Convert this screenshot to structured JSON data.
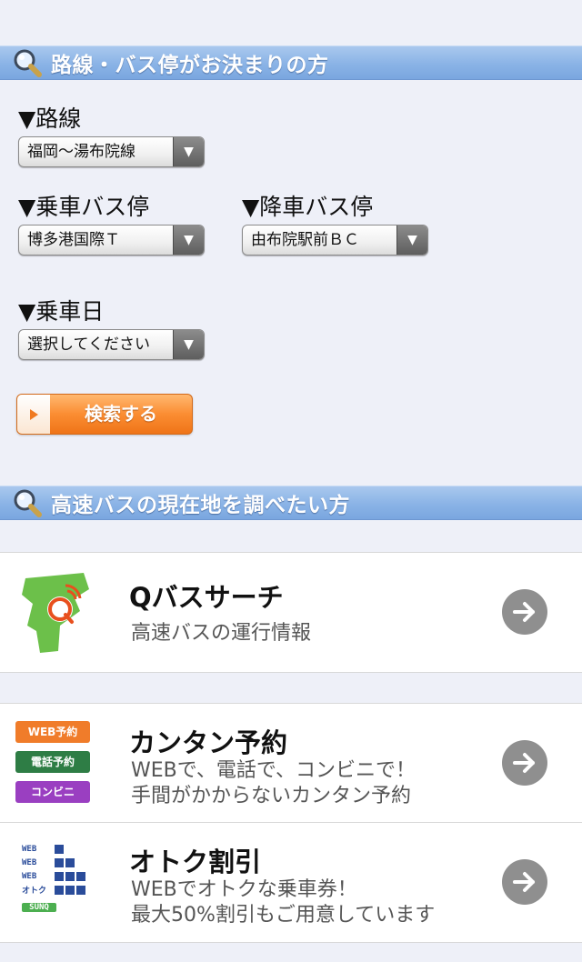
{
  "section1": {
    "title": "路線・バス停がお決まりの方"
  },
  "form": {
    "route_label": "▼路線",
    "route_value": "福岡～湯布院線",
    "board_label": "▼乗車バス停",
    "board_value": "博多港国際Ｔ",
    "alight_label": "▼降車バス停",
    "alight_value": "由布院駅前ＢＣ",
    "date_label": "▼乗車日",
    "date_value": "選択してください",
    "search_label": "検索する"
  },
  "section2": {
    "title": "高速バスの現在地を調べたい方"
  },
  "cards": [
    {
      "title": "Qバスサーチ",
      "lines": [
        "高速バスの運行情報"
      ]
    },
    {
      "title": "カンタン予約",
      "lines": [
        "WEBで、電話で、コンビニで！",
        "手間がかからないカンタン予約"
      ],
      "badges": [
        "WEB予約",
        "電話予約",
        "コンビニ"
      ]
    },
    {
      "title": "オトク割引",
      "lines": [
        "WEBでオトクな乗車券！",
        "最大50%割引もご用意しています"
      ],
      "mini_labels": [
        "WEB",
        "WEB",
        "WEB",
        "オトク",
        "SUNQ"
      ]
    }
  ],
  "colors": {
    "bar": "#8ab3e6",
    "button_orange": "#fb8d32",
    "badge_web": "#f07c2a",
    "badge_tel": "#2e7d45",
    "badge_conv": "#9a3fc1",
    "qlogo_green": "#6cc04a",
    "qlogo_orange": "#e8501e"
  }
}
